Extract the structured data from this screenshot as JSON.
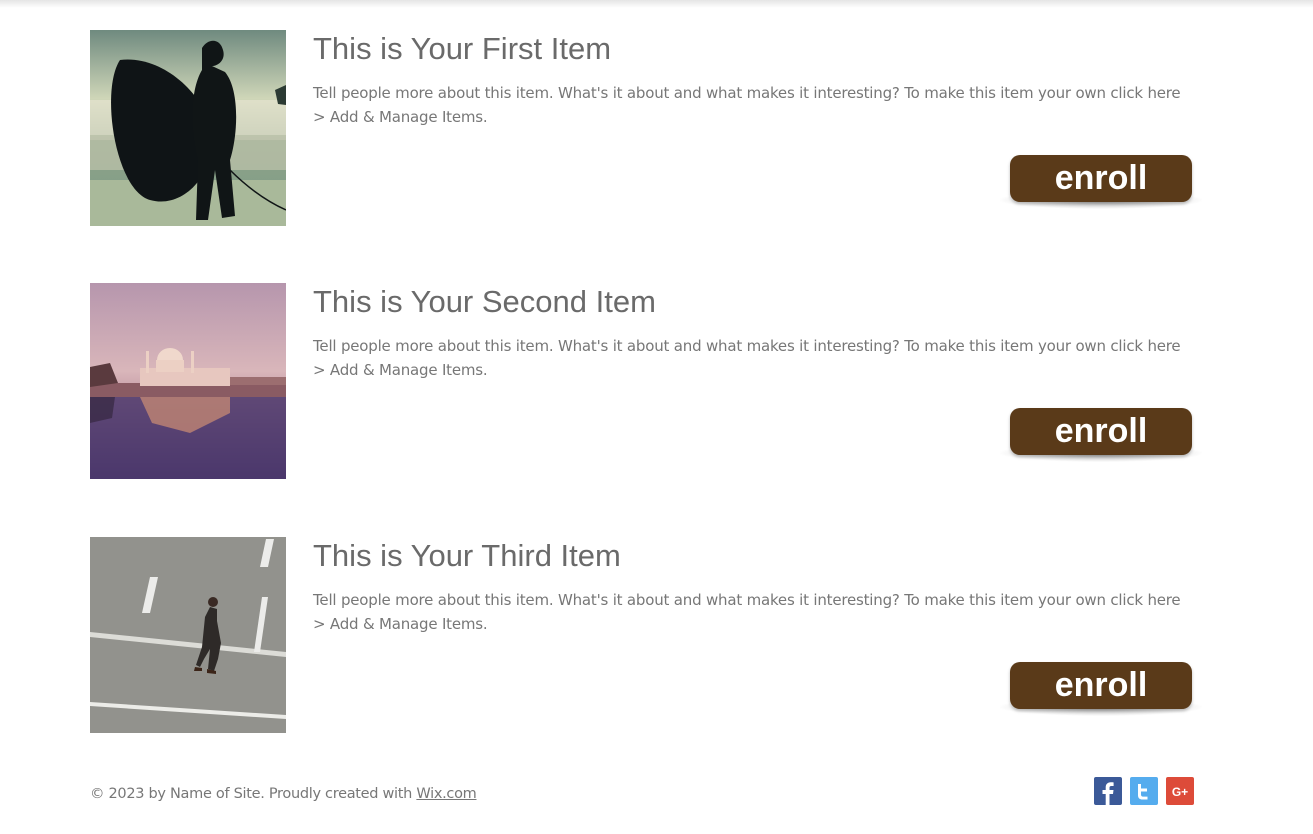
{
  "items": [
    {
      "title": "This is Your First Item",
      "description": "Tell people more about this item. What's it about and what makes it interesting? To make this item your own click here > Add & Manage Items.",
      "button_label": "enroll",
      "image": "surfer-silhouette-photo"
    },
    {
      "title": "This is Your Second Item",
      "description": "Tell people more about this item. What's it about and what makes it interesting? To make this item your own click here > Add & Manage Items.",
      "button_label": "enroll",
      "image": "taj-mahal-reflection-photo"
    },
    {
      "title": "This is Your Third Item",
      "description": "Tell people more about this item. What's it about and what makes it interesting? To make this item your own click here > Add & Manage Items.",
      "button_label": "enroll",
      "image": "man-walking-street-photo"
    }
  ],
  "footer": {
    "copyright": "© 2023 by Name of Site. Proudly created with ",
    "link_text": "Wix.com"
  },
  "social": [
    {
      "name": "facebook-icon",
      "glyph": "f",
      "color": "#3b5998"
    },
    {
      "name": "twitter-icon",
      "glyph": "t",
      "color": "#55acee"
    },
    {
      "name": "google-plus-icon",
      "glyph": "G+",
      "color": "#dd4b39"
    }
  ],
  "colors": {
    "button": "#5a3a19",
    "title": "#6a6a6a",
    "text": "#777777"
  }
}
